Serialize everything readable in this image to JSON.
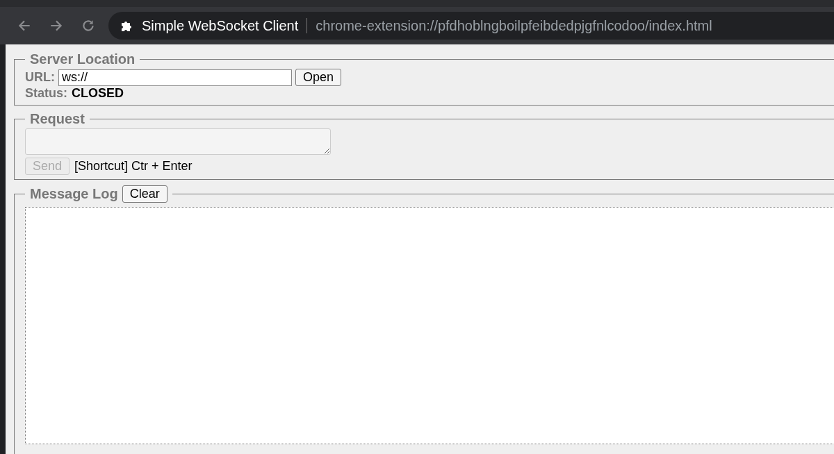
{
  "browser": {
    "page_title": "Simple WebSocket Client",
    "address": "chrome-extension://pfdhoblngboilpfeibdedpjgfnlcodoo/index.html"
  },
  "server_location": {
    "legend": "Server Location",
    "url_label": "URL:",
    "url_value": "ws://",
    "open_button": "Open",
    "status_label": "Status:",
    "status_value": "CLOSED"
  },
  "request": {
    "legend": "Request",
    "send_button": {
      "label": "Send",
      "disabled": true
    },
    "shortcut_hint": "[Shortcut] Ctr + Enter"
  },
  "message_log": {
    "legend": "Message Log",
    "clear_button": "Clear"
  }
}
